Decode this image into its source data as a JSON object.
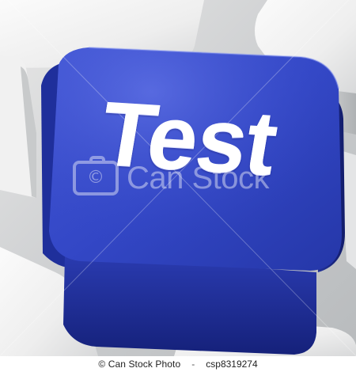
{
  "image": {
    "subject": "blue computer key",
    "key_label": "Test",
    "colors": {
      "key_blue": "#2b3fbb",
      "key_blue_top": "#3b50cf",
      "key_blue_side": "#1d2d95",
      "neighbor_key_light": "#ececec",
      "neighbor_key_shadow": "#a7aaad",
      "background_gray": "#d7d8d9"
    }
  },
  "watermark": {
    "text": "Can Stock",
    "camera_icon": "©"
  },
  "footer": {
    "copyright": "© Can Stock Photo",
    "separator": "-",
    "id": "csp8319274"
  }
}
